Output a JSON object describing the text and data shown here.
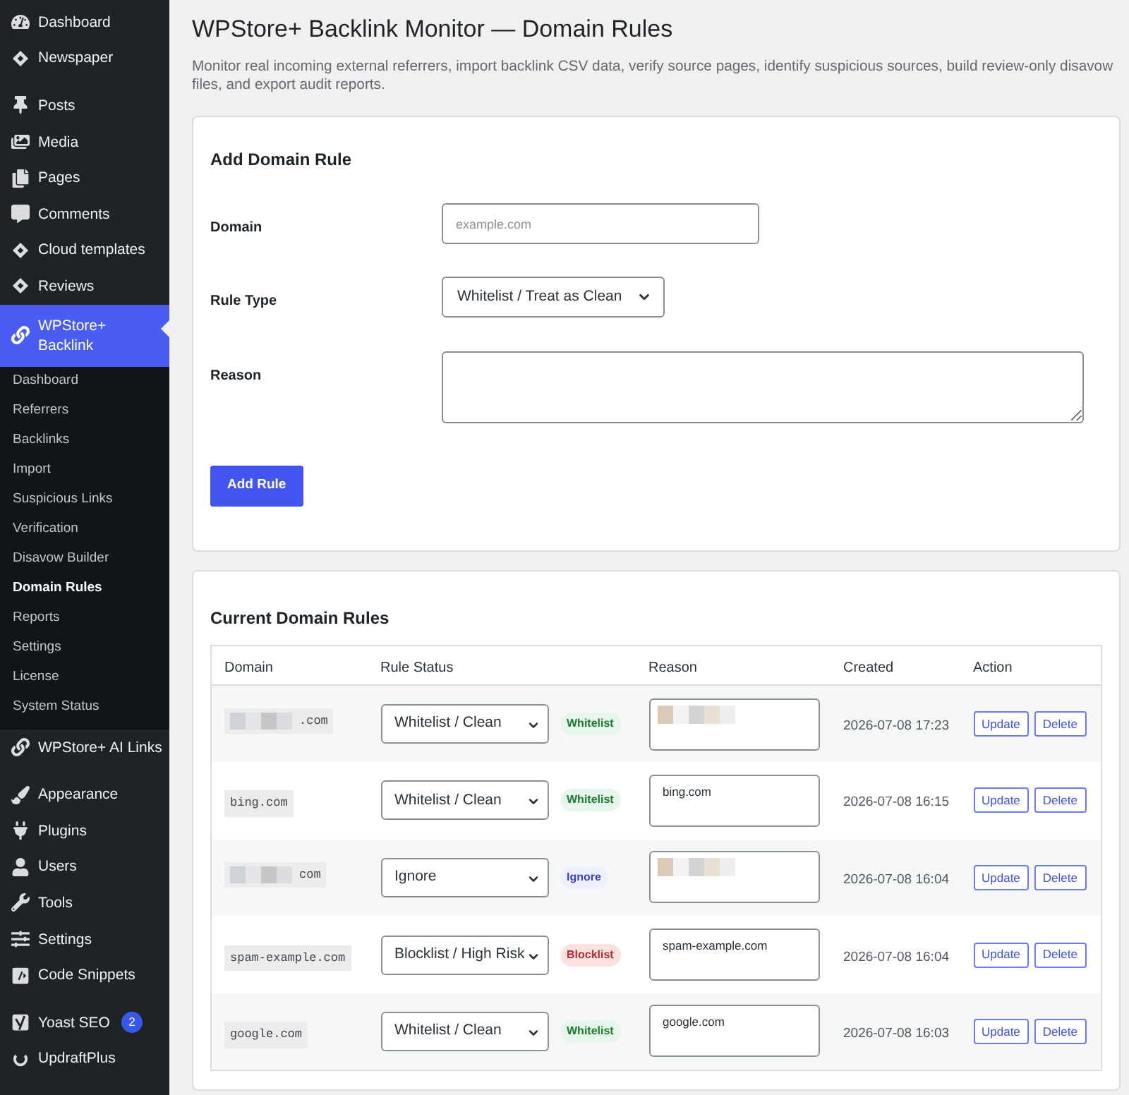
{
  "sidebar": {
    "groups": [
      {
        "items": [
          {
            "label": "Dashboard",
            "selected": false
          },
          {
            "label": "Newspaper",
            "selected": false
          }
        ]
      },
      {
        "items": [
          {
            "label": "Posts",
            "selected": false
          },
          {
            "label": "Media",
            "selected": false
          },
          {
            "label": "Pages",
            "selected": false
          },
          {
            "label": "Comments",
            "selected": false
          },
          {
            "label": "Cloud templates",
            "selected": false
          },
          {
            "label": "Reviews",
            "selected": false
          },
          {
            "label": "WPStore+ Backlink",
            "selected": true,
            "expanded": true,
            "children": [
              {
                "label": "Dashboard",
                "selected": false
              },
              {
                "label": "Referrers",
                "selected": false
              },
              {
                "label": "Backlinks",
                "selected": false
              },
              {
                "label": "Import",
                "selected": false
              },
              {
                "label": "Suspicious Links",
                "selected": false
              },
              {
                "label": "Verification",
                "selected": false
              },
              {
                "label": "Disavow Builder",
                "selected": false
              },
              {
                "label": "Domain Rules",
                "selected": true
              },
              {
                "label": "Reports",
                "selected": false
              },
              {
                "label": "Settings",
                "selected": false
              },
              {
                "label": "License",
                "selected": false
              },
              {
                "label": "System Status",
                "selected": false
              }
            ]
          },
          {
            "label": "WPStore+ AI Links",
            "selected": false
          }
        ]
      },
      {
        "items": [
          {
            "label": "Appearance",
            "selected": false
          },
          {
            "label": "Plugins",
            "selected": false
          },
          {
            "label": "Users",
            "selected": false
          },
          {
            "label": "Tools",
            "selected": false
          },
          {
            "label": "Settings",
            "selected": false
          },
          {
            "label": "Code Snippets",
            "selected": false
          }
        ]
      },
      {
        "items": [
          {
            "label": "Yoast SEO",
            "selected": false,
            "badge": "2"
          },
          {
            "label": "UpdraftPlus",
            "selected": false
          }
        ]
      }
    ]
  },
  "page": {
    "title": "WPStore+ Backlink Monitor — Domain Rules",
    "description": "Monitor real incoming external referrers, import backlink CSV data, verify source pages, identify suspicious sources, build review-only disavow files, and export audit reports."
  },
  "add_rule": {
    "title": "Add Domain Rule",
    "fields": [
      {
        "label": "Domain",
        "kind": "text",
        "placeholder": "example.com"
      },
      {
        "label": "Rule Type",
        "kind": "select",
        "value": "Whitelist / Treat as Clean"
      },
      {
        "label": "Reason",
        "kind": "textarea"
      }
    ],
    "button": "Add Rule"
  },
  "rules_table": {
    "title": "Current Domain Rules",
    "columns": [
      "Domain",
      "Rule Status",
      "Reason",
      "Created",
      "Action"
    ],
    "rows": [
      {
        "domain": {
          "text": ".com",
          "redacted": true
        },
        "status": "Whitelist / Clean",
        "badge": {
          "label": "Whitelist",
          "kind": "whitelist"
        },
        "reason": {
          "redacted": true
        },
        "created": "2026-07-08 17:23",
        "actions": [
          "Update",
          "Delete"
        ]
      },
      {
        "domain": {
          "text": "bing.com",
          "redacted": false
        },
        "status": "Whitelist / Clean",
        "badge": {
          "label": "Whitelist",
          "kind": "whitelist"
        },
        "reason": {
          "value": "bing.com",
          "redacted": false
        },
        "created": "2026-07-08 16:15",
        "actions": [
          "Update",
          "Delete"
        ]
      },
      {
        "domain": {
          "text": "com",
          "redacted": true
        },
        "status": "Ignore",
        "badge": {
          "label": "Ignore",
          "kind": "ignore"
        },
        "reason": {
          "redacted": true
        },
        "created": "2026-07-08 16:04",
        "actions": [
          "Update",
          "Delete"
        ]
      },
      {
        "domain": {
          "text": "spam-example.com",
          "redacted": false
        },
        "status": "Blocklist / High Risk",
        "badge": {
          "label": "Blocklist",
          "kind": "blocklist"
        },
        "reason": {
          "value": "spam-example.com",
          "redacted": false
        },
        "created": "2026-07-08 16:04",
        "actions": [
          "Update",
          "Delete"
        ]
      },
      {
        "domain": {
          "text": "google.com",
          "redacted": false
        },
        "status": "Whitelist / Clean",
        "badge": {
          "label": "Whitelist",
          "kind": "whitelist"
        },
        "reason": {
          "value": "google.com",
          "redacted": false
        },
        "created": "2026-07-08 16:03",
        "actions": [
          "Update",
          "Delete"
        ]
      }
    ]
  }
}
